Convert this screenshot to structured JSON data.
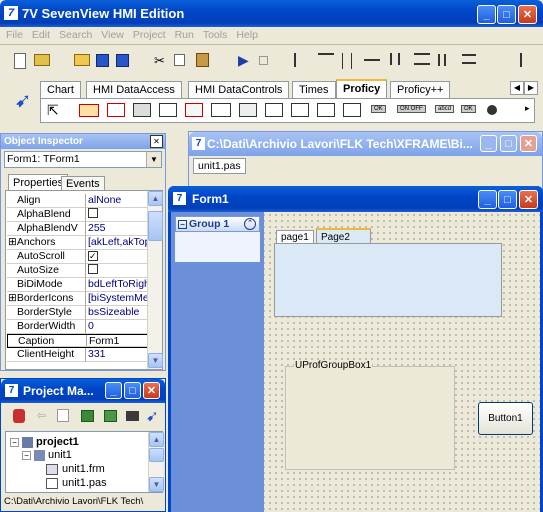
{
  "app": {
    "title": "7V SevenView HMI Edition"
  },
  "menu": [
    "File",
    "Edit",
    "Search",
    "View",
    "Project",
    "Run",
    "Tools",
    "Help"
  ],
  "palette": {
    "tabs": [
      "Chart",
      "HMI DataAccess",
      "HMI DataControls",
      "Times",
      "Proficy",
      "Proficy++"
    ],
    "active": "Proficy",
    "btn_ok": "OK",
    "btn_onoff": "ON OFF",
    "btn_abcd": "abcd",
    "btn_ok2": "OK"
  },
  "inspector": {
    "title": "Object Inspector",
    "selector": "Form1: TForm1",
    "tab_properties": "Properties",
    "tab_events": "Events",
    "props": [
      {
        "name": "Align",
        "value": "alNone"
      },
      {
        "name": "AlphaBlend",
        "value": ""
      },
      {
        "name": "AlphaBlendV",
        "value": "255"
      },
      {
        "name": "Anchors",
        "value": "[akLeft,akTop"
      },
      {
        "name": "AutoScroll",
        "value": ""
      },
      {
        "name": "AutoSize",
        "value": ""
      },
      {
        "name": "BiDiMode",
        "value": "bdLeftToRight"
      },
      {
        "name": "BorderIcons",
        "value": "[biSystemMen"
      },
      {
        "name": "BorderStyle",
        "value": "bsSizeable"
      },
      {
        "name": "BorderWidth",
        "value": "0"
      },
      {
        "name": "Caption",
        "value": "Form1"
      },
      {
        "name": "ClientHeight",
        "value": "331"
      }
    ]
  },
  "editor": {
    "title": "C:\\Dati\\Archivio Lavori\\FLK Tech\\XFRAME\\Bi...",
    "tab": "unit1.pas"
  },
  "form": {
    "title": "Form1",
    "group_label": "Group 1",
    "page_tabs": [
      "page1",
      "Page2"
    ],
    "groupbox_label": "UProfGroupBox1",
    "button_label": "Button1"
  },
  "project": {
    "title": "Project Ma...",
    "root": "project1",
    "unit": "unit1",
    "files": [
      "unit1.frm",
      "unit1.pas"
    ],
    "status": "C:\\Dati\\Archivio Lavori\\FLK Tech\\"
  }
}
